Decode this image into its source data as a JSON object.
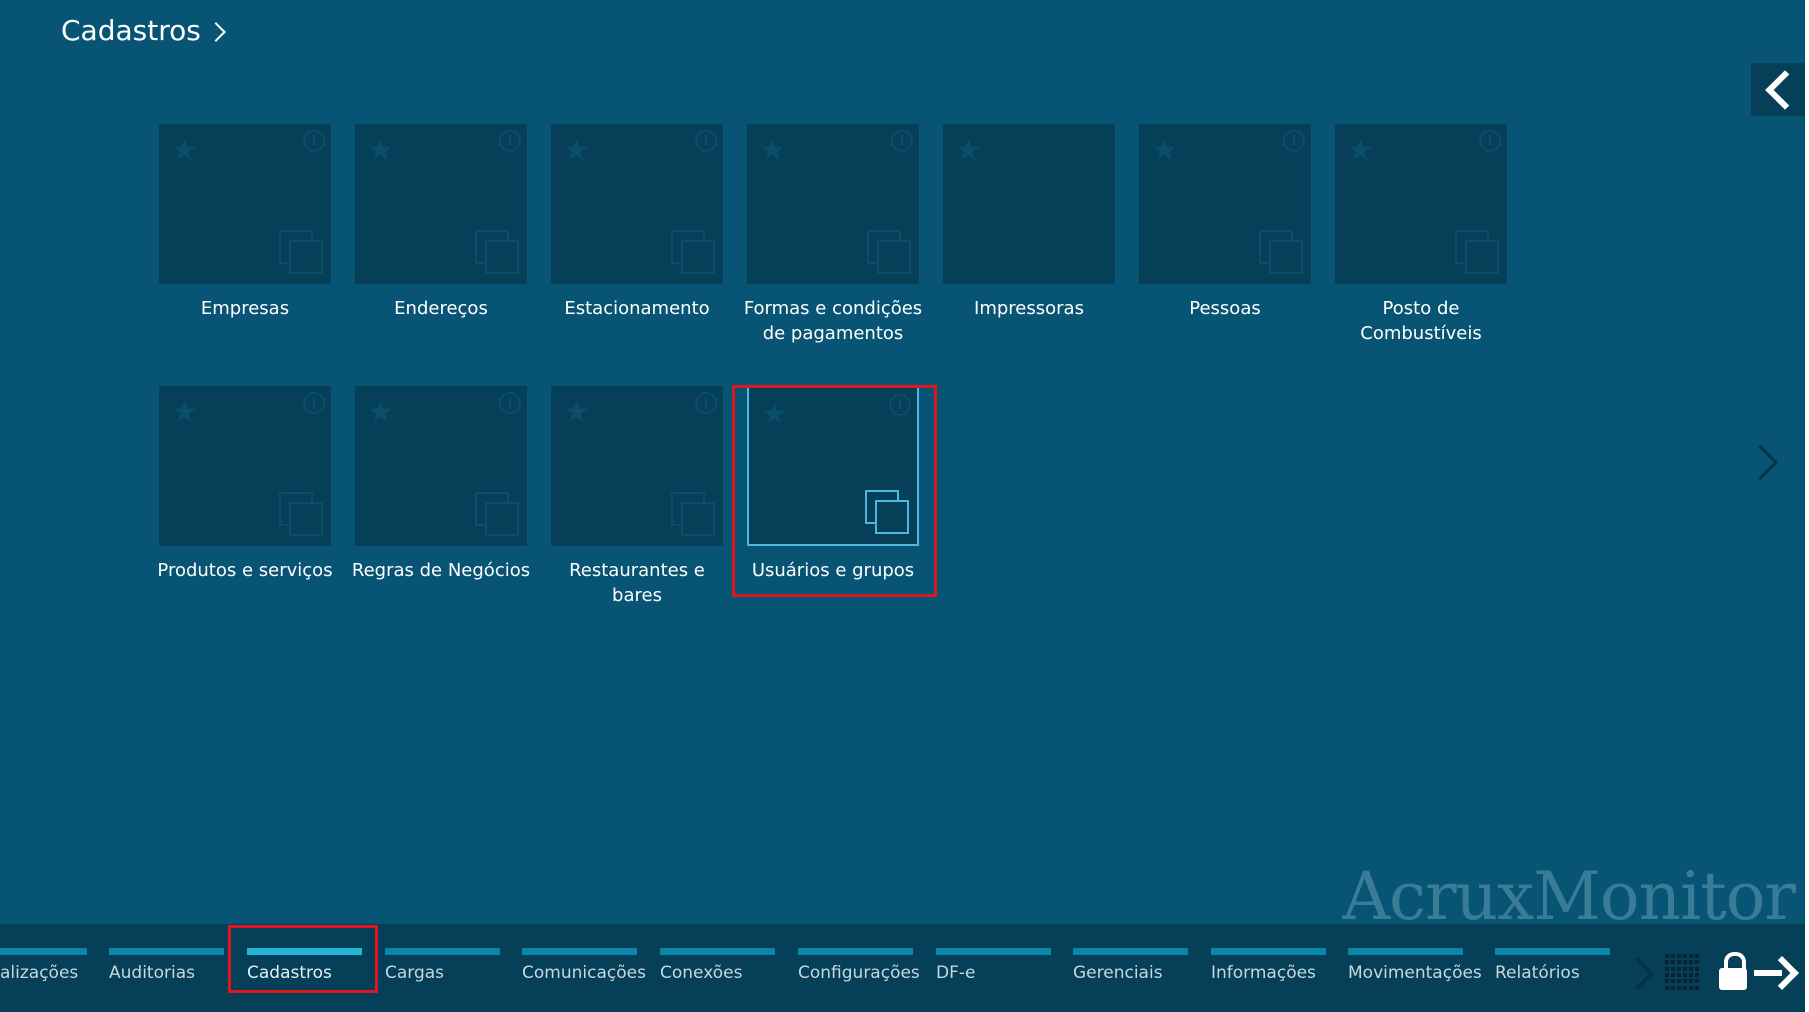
{
  "breadcrumb": {
    "title": "Cadastros"
  },
  "tiles": [
    {
      "label": "Empresas",
      "info": "i"
    },
    {
      "label": "Endereços",
      "info": "i"
    },
    {
      "label": "Estacionamento",
      "info": "i"
    },
    {
      "label": "Formas e condições de pagamentos",
      "info": "i"
    },
    {
      "label": "Impressoras",
      "info": ""
    },
    {
      "label": "Pessoas",
      "info": "i"
    },
    {
      "label": "Posto de Combustíveis",
      "info": "i"
    },
    {
      "label": "Produtos e serviços",
      "info": "i"
    },
    {
      "label": "Regras de Negócios",
      "info": "i"
    },
    {
      "label": "Restaurantes e bares",
      "info": "i"
    },
    {
      "label": "Usuários e grupos",
      "info": "i",
      "selected": true
    }
  ],
  "star_glyph": "★",
  "watermark": "AcruxMonitor",
  "bottom_nav": {
    "tabs": [
      {
        "label": "alizações"
      },
      {
        "label": "Auditorias"
      },
      {
        "label": "Cadastros",
        "active": true
      },
      {
        "label": "Cargas"
      },
      {
        "label": "Comunicações"
      },
      {
        "label": "Conexões"
      },
      {
        "label": "Configurações"
      },
      {
        "label": "DF-e"
      },
      {
        "label": "Gerenciais"
      },
      {
        "label": "Informações"
      },
      {
        "label": "Movimentações"
      },
      {
        "label": "Relatórios"
      }
    ]
  },
  "colors": {
    "background": "#085474",
    "tile": "#053f58",
    "bottom_bar": "#053f58",
    "tab_line": "#0a87a8",
    "tab_line_active": "#23b5d8",
    "selected_border": "#4fb6e0",
    "highlight": "#e0161f"
  },
  "icons": [
    "chevron-right-icon",
    "collapse-left-icon",
    "star-icon",
    "info-icon",
    "copy-icon",
    "grid-icon",
    "lock-icon",
    "logout-arrow-icon"
  ]
}
